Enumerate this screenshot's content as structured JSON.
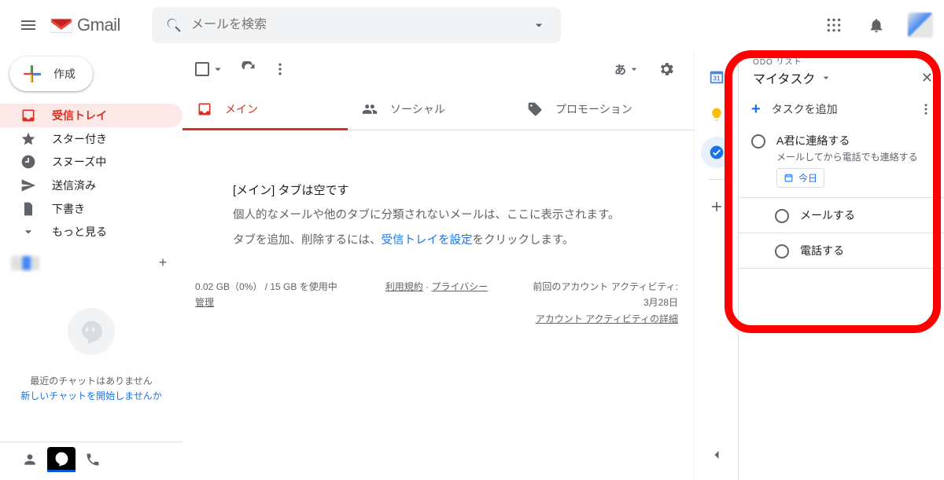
{
  "app": {
    "name": "Gmail"
  },
  "search": {
    "placeholder": "メールを検索"
  },
  "compose": {
    "label": "作成"
  },
  "nav": {
    "inbox": "受信トレイ",
    "starred": "スター付き",
    "snoozed": "スヌーズ中",
    "sent": "送信済み",
    "drafts": "下書き",
    "more": "もっと見る"
  },
  "hangouts": {
    "no_chat": "最近のチャットはありません",
    "start_chat": "新しいチャットを開始しませんか"
  },
  "toolbar": {
    "lang": "あ"
  },
  "tabs": {
    "primary": "メイン",
    "social": "ソーシャル",
    "promotions": "プロモーション"
  },
  "empty": {
    "title": "[メイン] タブは空です",
    "line1": "個人的なメールや他のタブに分類されないメールは、ここに表示されます。",
    "line2a": "タブを追加、削除するには、",
    "link": "受信トレイを設定",
    "line2b": "をクリックします。"
  },
  "footer": {
    "storage": "0.02 GB（0%） / 15 GB を使用中",
    "manage": "管理",
    "terms": "利用規約",
    "privacy": "プライバシー",
    "activity": "前回のアカウント アクティビティ: 3月28日",
    "activity_link": "アカウント アクティビティの詳細"
  },
  "tasks": {
    "subtitle": "ODO リスト",
    "list_name": "マイタスク",
    "add": "タスクを追加",
    "items": [
      {
        "title": "A君に連絡する",
        "desc": "メールしてから電話でも連絡する",
        "chip": "今日"
      },
      {
        "title": "メールする"
      },
      {
        "title": "電話する"
      }
    ]
  }
}
